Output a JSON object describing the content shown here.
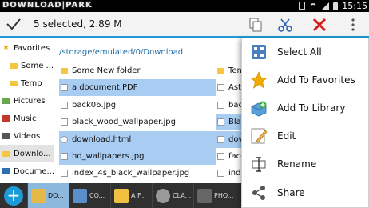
{
  "status_bar": {
    "logo_text": "DOWNLOAD|PARK",
    "time": "15:15",
    "icons": [
      "usb-icon",
      "wifi-icon",
      "signal-icon",
      "battery-icon"
    ]
  },
  "action_bar": {
    "selection_label": "5 selected, 2.89 M",
    "buttons": [
      "check-icon",
      "copy-icon",
      "cut-icon",
      "delete-icon",
      "overflow-menu-icon"
    ],
    "accent_color": "#1e9bd7",
    "delete_color": "#d42020"
  },
  "sidebar": {
    "items": [
      {
        "label": "Favorites",
        "icon": "star-icon",
        "level": "top"
      },
      {
        "label": "Some ...",
        "icon": "folder-icon",
        "level": "child"
      },
      {
        "label": "Temp",
        "icon": "folder-icon",
        "level": "child"
      },
      {
        "label": "Pictures",
        "icon": "pictures-icon",
        "level": "top"
      },
      {
        "label": "Music",
        "icon": "music-icon",
        "level": "top"
      },
      {
        "label": "Videos",
        "icon": "videos-icon",
        "level": "top"
      },
      {
        "label": "Downlo...",
        "icon": "download-icon",
        "level": "top"
      },
      {
        "label": "Docume...",
        "icon": "documents-icon",
        "level": "top"
      }
    ]
  },
  "file_list": {
    "path": "/storage/emulated/0/Download",
    "files": [
      {
        "name": "Some New folder",
        "type": "folder",
        "selected": false
      },
      {
        "name": "a document.PDF",
        "type": "pdf",
        "selected": true
      },
      {
        "name": "back06.jpg",
        "type": "image",
        "selected": false
      },
      {
        "name": "black_wood_wallpaper.jpg",
        "type": "image",
        "selected": false
      },
      {
        "name": "download.html",
        "type": "html",
        "selected": true
      },
      {
        "name": "hd_wallpapers.jpg",
        "type": "image",
        "selected": true
      },
      {
        "name": "index_4s_black_wallpaper.jpg",
        "type": "image",
        "selected": false
      }
    ],
    "second_column": [
      {
        "name": "Ten",
        "type": "folder",
        "selected": false
      },
      {
        "name": "Astr",
        "type": "image",
        "selected": false
      },
      {
        "name": "bac",
        "type": "image",
        "selected": false
      },
      {
        "name": "Bla",
        "type": "image",
        "selected": true
      },
      {
        "name": "dow",
        "type": "file",
        "selected": true
      },
      {
        "name": "face",
        "type": "image",
        "selected": false
      },
      {
        "name": "inde",
        "type": "image",
        "selected": false
      }
    ],
    "selected_color": "#a9cdf2"
  },
  "context_menu": {
    "items": [
      {
        "label": "Select All",
        "icon": "select-all-icon"
      },
      {
        "label": "Add To Favorites",
        "icon": "star-icon"
      },
      {
        "label": "Add To Library",
        "icon": "library-icon"
      },
      {
        "label": "Edit",
        "icon": "edit-icon"
      },
      {
        "label": "Rename",
        "icon": "rename-icon"
      },
      {
        "label": "Share",
        "icon": "share-icon"
      }
    ]
  },
  "bottom_bar": {
    "add_label": "+",
    "tabs": [
      {
        "label": "DO...",
        "icon": "download-folder-icon",
        "active": true
      },
      {
        "label": "CO...",
        "icon": "computer-icon",
        "active": false
      },
      {
        "label": "A F...",
        "icon": "folder-icon",
        "active": false
      },
      {
        "label": "CLA...",
        "icon": "watch-icon",
        "active": false
      },
      {
        "label": "PHO...",
        "icon": "camera-icon",
        "active": false
      }
    ]
  }
}
